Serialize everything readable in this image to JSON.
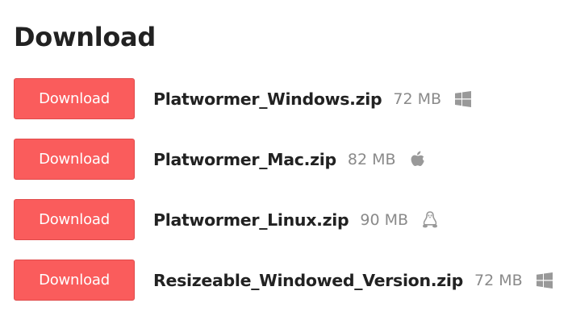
{
  "heading": "Download",
  "uploads": [
    {
      "button_label": "Download",
      "file_name": "Platwormer_Windows.zip",
      "file_size": "72 MB",
      "platform_icon": "windows-icon"
    },
    {
      "button_label": "Download",
      "file_name": "Platwormer_Mac.zip",
      "file_size": "82 MB",
      "platform_icon": "apple-icon"
    },
    {
      "button_label": "Download",
      "file_name": "Platwormer_Linux.zip",
      "file_size": "90 MB",
      "platform_icon": "linux-icon"
    },
    {
      "button_label": "Download",
      "file_name": "Resizeable_Windowed_Version.zip",
      "file_size": "72 MB",
      "platform_icon": "windows-icon"
    }
  ],
  "colors": {
    "button_bg": "#fa5c5c",
    "button_text": "#ffffff",
    "file_name": "#222222",
    "file_size": "#8a8a8a",
    "icon": "#999999"
  }
}
